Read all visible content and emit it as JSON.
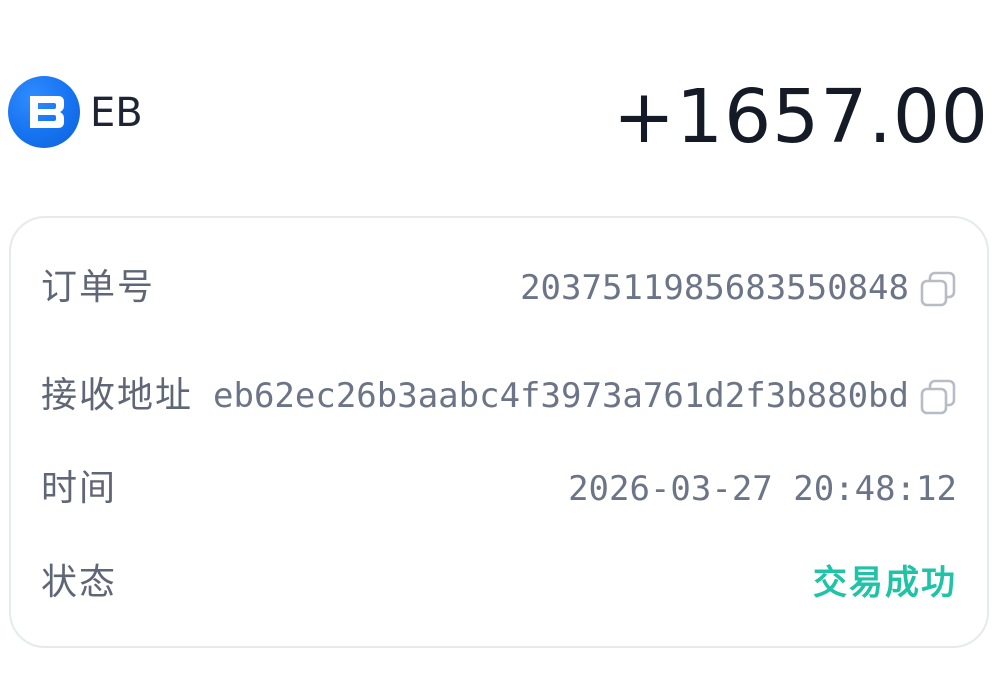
{
  "header": {
    "coin_icon": "eb-coin-logo",
    "coin_name": "EB",
    "amount": "+1657.00"
  },
  "details": {
    "order_no": {
      "label": "订单号",
      "value": "2037511985683550848",
      "action_icon": "copy-icon"
    },
    "receive_address": {
      "label": "接收地址",
      "value": "eb62ec26b3aabc4f3973a761d2f3b880bd",
      "action_icon": "copy-icon"
    },
    "time": {
      "label": "时间",
      "value": "2026-03-27 20:48:12"
    },
    "status": {
      "label": "状态",
      "value": "交易成功"
    }
  },
  "colors": {
    "accent": "#1673f0",
    "status_success": "#1fc3a5",
    "label": "#5f6675",
    "value": "#6b7587",
    "amount": "#141a26",
    "card_border": "#e6e9ee"
  }
}
